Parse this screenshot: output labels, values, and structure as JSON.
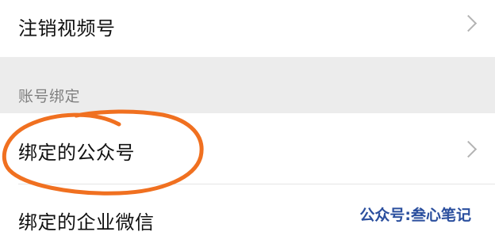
{
  "rows": {
    "cancel_channel": "注销视频号",
    "bound_official_account": "绑定的公众号",
    "bound_wecom": "绑定的企业微信"
  },
  "section": {
    "title": "账号绑定"
  },
  "watermark": {
    "text": "公众号:叁心笔记"
  },
  "colors": {
    "highlight_circle": "#f07020",
    "watermark": "#2b4f9e",
    "section_background": "#ececec"
  },
  "icons": {
    "row_arrow": "chevron-right-icon"
  }
}
